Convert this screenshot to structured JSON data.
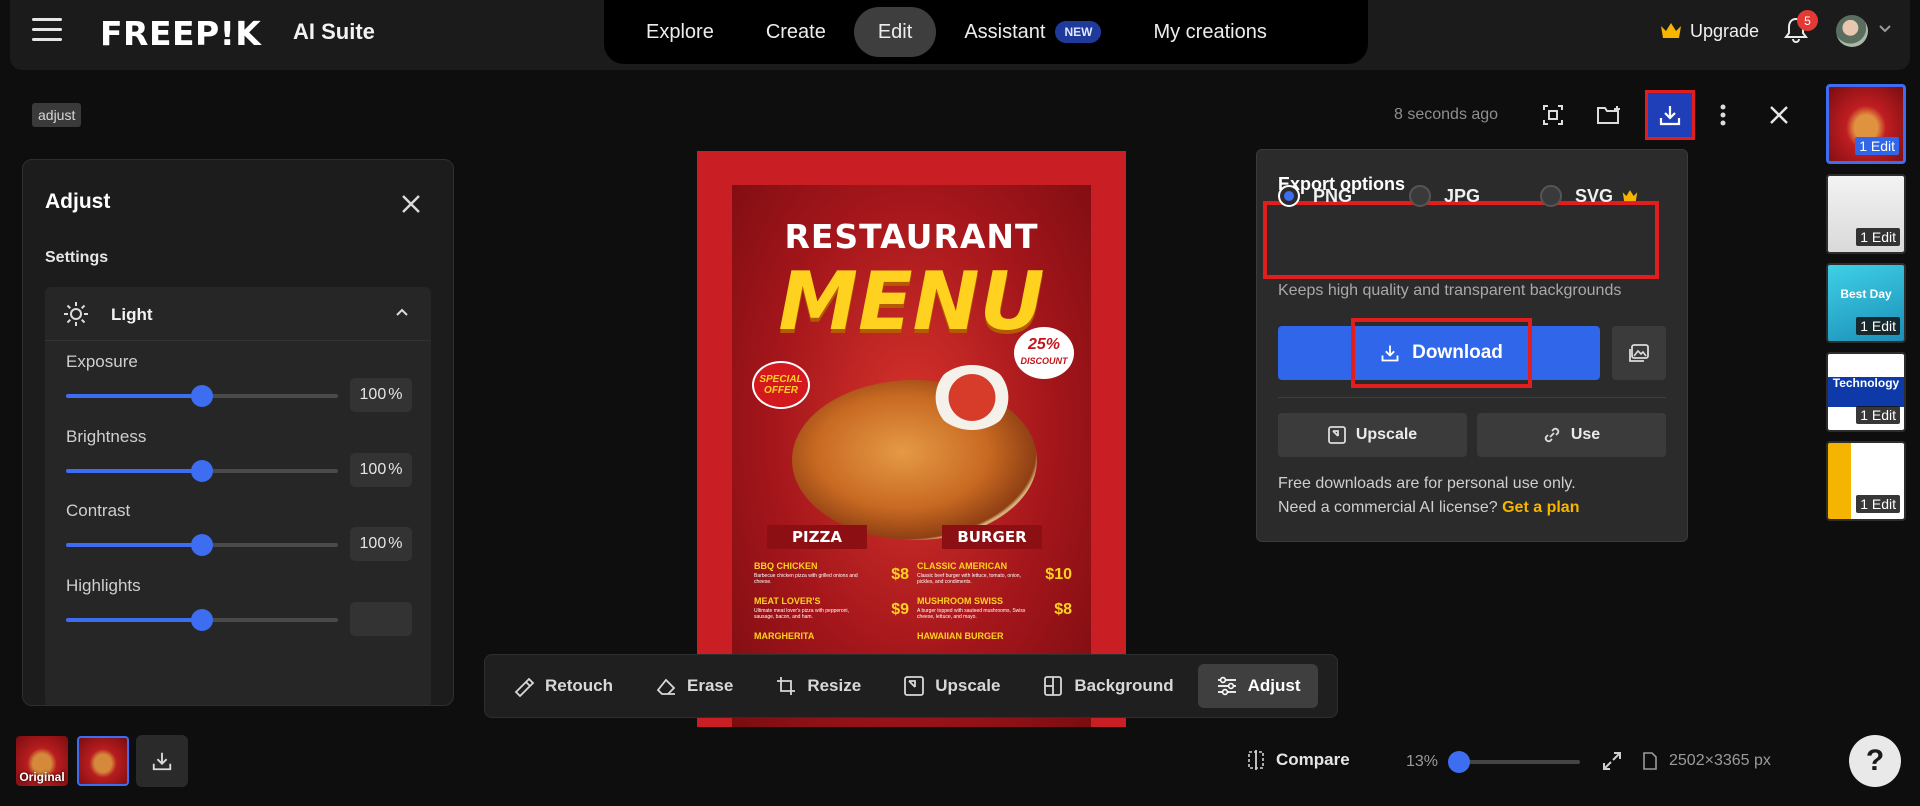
{
  "app": {
    "logo_text": "FREEP!K",
    "suite_label": "AI Suite"
  },
  "nav": {
    "items": [
      {
        "label": "Explore",
        "active": false
      },
      {
        "label": "Create",
        "active": false
      },
      {
        "label": "Edit",
        "active": true
      },
      {
        "label": "Assistant",
        "active": false,
        "badge": "NEW"
      },
      {
        "label": "My creations",
        "active": false
      }
    ]
  },
  "header_right": {
    "upgrade_label": "Upgrade",
    "notifications_count": "5"
  },
  "tag": "adjust",
  "adjust_panel": {
    "title": "Adjust",
    "settings_label": "Settings",
    "section_label": "Light",
    "sliders": [
      {
        "label": "Exposure",
        "value": "100",
        "unit": "%",
        "fraction": 0.5
      },
      {
        "label": "Brightness",
        "value": "100",
        "unit": "%",
        "fraction": 0.5
      },
      {
        "label": "Contrast",
        "value": "100",
        "unit": "%",
        "fraction": 0.5
      },
      {
        "label": "Highlights",
        "value": "",
        "unit": "",
        "fraction": 0.5
      }
    ]
  },
  "poster": {
    "title_line1": "RESTAURANT",
    "title_line2": "MENU",
    "discount_value": "25%",
    "discount_label": "DISCOUNT",
    "special_offer": "SPECIAL OFFER",
    "tab_left": "PIZZA",
    "tab_right": "BURGER",
    "items_left": [
      {
        "name": "BBQ CHICKEN",
        "desc": "Barbecue chicken pizza with grilled onions and cheese.",
        "price": "$8"
      },
      {
        "name": "MEAT LOVER'S",
        "desc": "Ultimate meat lover's pizza with pepperoni, sausage, bacon, and ham.",
        "price": "$9"
      },
      {
        "name": "MARGHERITA",
        "desc": "",
        "price": ""
      }
    ],
    "items_right": [
      {
        "name": "CLASSIC AMERICAN",
        "desc": "Classic beef burger with lettuce, tomato, onion, pickles, and condiments.",
        "price": "$10"
      },
      {
        "name": "MUSHROOM SWISS",
        "desc": "A burger topped with sauteed mushrooms, Swiss cheese, lettuce, and mayo.",
        "price": "$8"
      },
      {
        "name": "HAWAIIAN BURGER",
        "desc": "",
        "price": ""
      }
    ]
  },
  "toolbar_top": {
    "timestamp": "8 seconds ago"
  },
  "export": {
    "title": "Export options",
    "formats": [
      {
        "label": "PNG",
        "checked": true
      },
      {
        "label": "JPG",
        "checked": false
      },
      {
        "label": "SVG",
        "checked": false,
        "premium": true
      }
    ],
    "hint": "Keeps high quality and transparent backgrounds",
    "download_label": "Download",
    "upscale_label": "Upscale",
    "use_label": "Use",
    "license_line1": "Free downloads are for personal use only.",
    "license_line2": "Need a commercial AI license?",
    "get_plan_label": "Get a plan"
  },
  "history_thumbs": [
    {
      "tag": "1 Edit",
      "active": true,
      "theme": "menu"
    },
    {
      "tag": "1 Edit",
      "active": false,
      "theme": "invite"
    },
    {
      "tag": "1 Edit",
      "active": false,
      "theme": "bestday",
      "art_text": "Best Day"
    },
    {
      "tag": "1 Edit",
      "active": false,
      "theme": "tech",
      "art_text": "Technology"
    },
    {
      "tag": "1 Edit",
      "active": false,
      "theme": "card"
    }
  ],
  "tools": [
    {
      "label": "Retouch",
      "icon": "retouch-icon",
      "active": false
    },
    {
      "label": "Erase",
      "icon": "eraser-icon",
      "active": false
    },
    {
      "label": "Resize",
      "icon": "crop-icon",
      "active": false
    },
    {
      "label": "Upscale",
      "icon": "upscale-icon",
      "active": false
    },
    {
      "label": "Background",
      "icon": "background-icon",
      "active": false
    },
    {
      "label": "Adjust",
      "icon": "sliders-icon",
      "active": true
    }
  ],
  "bottom": {
    "original_label": "Original",
    "compare_label": "Compare",
    "zoom": "13%",
    "zoom_fraction": 0.07,
    "dimensions": "2502×3365 px",
    "help_label": "?"
  },
  "colors": {
    "accent": "#2f66ea",
    "highlight_red": "#e21d1d",
    "plan_yellow": "#f7b500"
  }
}
